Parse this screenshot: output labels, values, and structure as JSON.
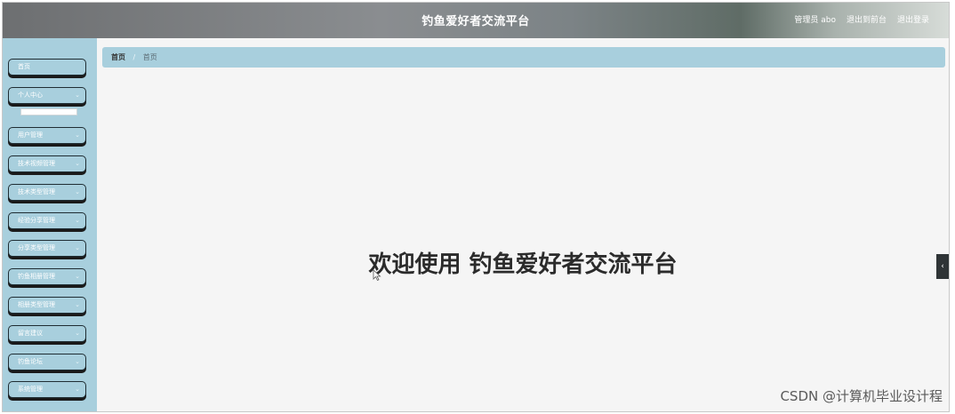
{
  "header": {
    "title": "钓鱼爱好者交流平台",
    "user_label": "管理员 abo",
    "to_front": "退出到前台",
    "logout": "退出登录"
  },
  "sidebar": {
    "items": [
      {
        "label": "首页",
        "chevron": ""
      },
      {
        "label": "个人中心",
        "chevron": "⌄"
      },
      {
        "label": "用户管理",
        "chevron": "⌄"
      },
      {
        "label": "技术视频管理",
        "chevron": "⌄"
      },
      {
        "label": "技术类型管理",
        "chevron": "⌄"
      },
      {
        "label": "经验分享管理",
        "chevron": "⌄"
      },
      {
        "label": "分享类型管理",
        "chevron": "⌄"
      },
      {
        "label": "钓鱼相册管理",
        "chevron": "⌄"
      },
      {
        "label": "相册类型管理",
        "chevron": "⌄"
      },
      {
        "label": "留言建议",
        "chevron": "⌄"
      },
      {
        "label": "钓鱼论坛",
        "chevron": "⌄"
      },
      {
        "label": "系统管理",
        "chevron": "⌄"
      }
    ]
  },
  "breadcrumb": {
    "home": "首页",
    "separator": "/",
    "current": "首页"
  },
  "main": {
    "welcome": "欢迎使用 钓鱼爱好者交流平台"
  },
  "collapse_toggle": "‹",
  "watermark": "CSDN @计算机毕业设计程"
}
